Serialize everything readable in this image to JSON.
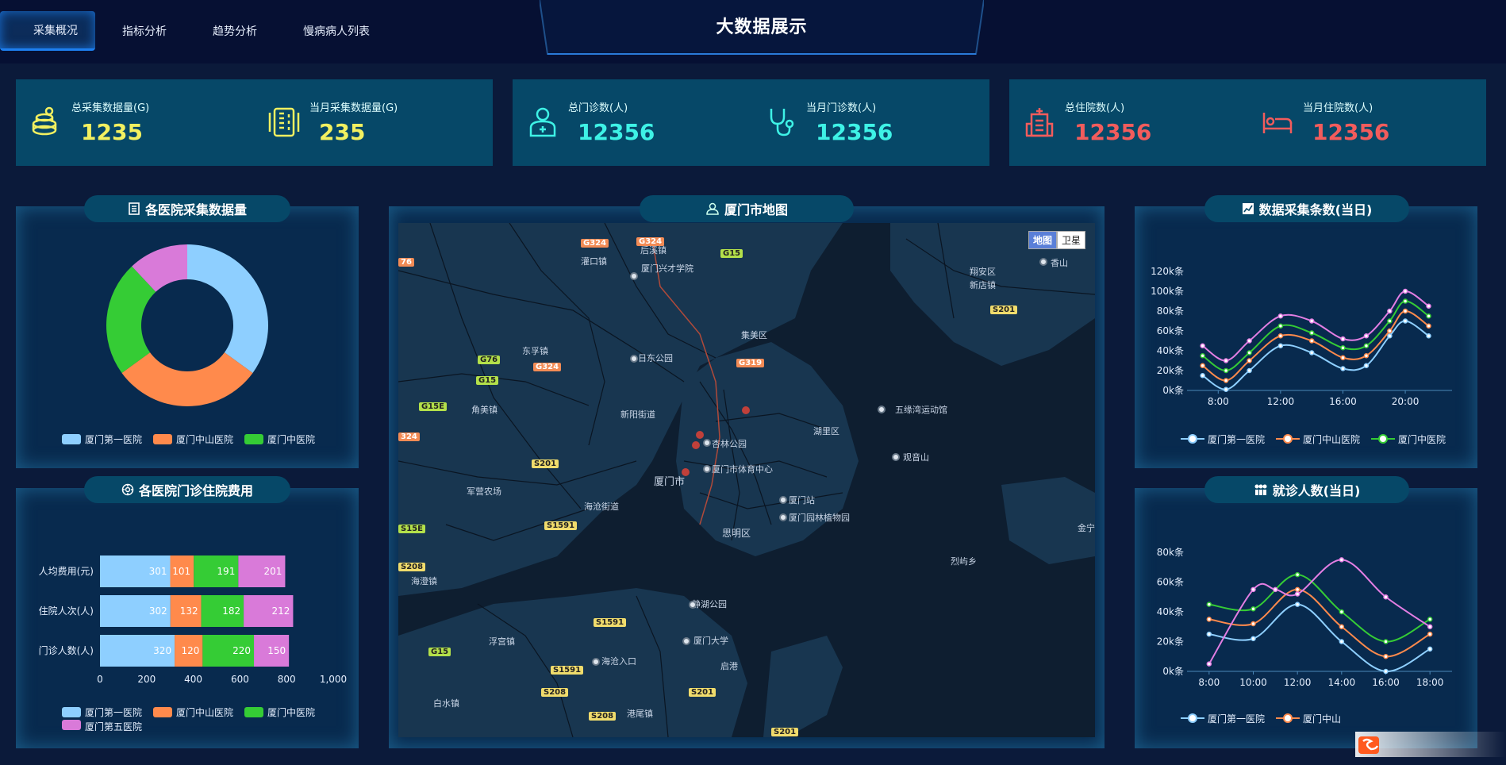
{
  "nav": {
    "tabs": [
      {
        "label": "采集概况",
        "active": true
      },
      {
        "label": "指标分析",
        "active": false
      },
      {
        "label": "趋势分析",
        "active": false
      },
      {
        "label": "慢病病人列表",
        "active": false
      }
    ]
  },
  "page_title": "大数据展示",
  "stats": [
    {
      "label": "总采集数据量(G)",
      "value": "1235",
      "color": "#f2f060",
      "icon": "database-coin-icon"
    },
    {
      "label": "当月采集数据量(G)",
      "value": "235",
      "color": "#f2f060",
      "icon": "server-rack-icon"
    },
    {
      "label": "总门诊数(人)",
      "value": "12356",
      "color": "#3ef2e6",
      "icon": "doctor-icon"
    },
    {
      "label": "当月门诊数(人)",
      "value": "12356",
      "color": "#3ef2e6",
      "icon": "stethoscope-icon"
    },
    {
      "label": "总住院数(人)",
      "value": "12356",
      "color": "#f25c5c",
      "icon": "hospital-icon"
    },
    {
      "label": "当月住院数(人)",
      "value": "12356",
      "color": "#f25c5c",
      "icon": "hospital-bed-icon"
    }
  ],
  "panels": {
    "donut_title": "各医院采集数据量",
    "bar_title": "各医院门诊住院费用",
    "map_title": "厦门市地图",
    "line1_title": "数据采集条数(当日)",
    "line2_title": "就诊人数(当日)"
  },
  "map": {
    "toggle": [
      "地图",
      "卫星"
    ],
    "labels": [
      "灌口镇",
      "后溪镇",
      "厦门兴才学院",
      "集美区",
      "日东公园",
      "东孚镇",
      "角美镇",
      "新阳街道",
      "杏林公园",
      "湖里区",
      "厦门市体育中心",
      "厦门市",
      "厦门站",
      "思明区",
      "厦门园林植物园",
      "五缘湾运动馆",
      "观音山",
      "翔安区",
      "新店镇",
      "香山",
      "军营农场",
      "海沧街道",
      "海澄镇",
      "静湖公园",
      "浮宫镇",
      "厦门大学",
      "海沧入口",
      "白水镇",
      "港尾镇",
      "启港",
      "烈屿乡",
      "金宁"
    ],
    "badges": [
      "G324",
      "G324",
      "G15",
      "G76",
      "G324",
      "G319",
      "G15",
      "G15E",
      "S201",
      "S201",
      "S1591",
      "S15E",
      "S208",
      "S1591",
      "G15",
      "S1591",
      "S208",
      "S201",
      "S208",
      "S201",
      "324",
      "76"
    ]
  },
  "chart_data": [
    {
      "type": "pie",
      "title": "各医院采集数据量",
      "donut": true,
      "slices": [
        {
          "name": "厦门第一医院",
          "value": 35,
          "color": "#8ecfff"
        },
        {
          "name": "厦门中山医院",
          "value": 30,
          "color": "#ff8a4c"
        },
        {
          "name": "厦门中医院",
          "value": 23,
          "color": "#35cc35"
        },
        {
          "name": "",
          "value": 12,
          "color": "#d97ad9"
        }
      ],
      "legend": [
        "厦门第一医院",
        "厦门中山医院",
        "厦门中医院"
      ],
      "legend_placement": "bottom"
    },
    {
      "type": "bar",
      "orientation": "horizontal",
      "stacked": true,
      "title": "各医院门诊住院费用",
      "categories": [
        "人均费用(元)",
        "住院人次(人)",
        "门诊人数(人)"
      ],
      "series": [
        {
          "name": "厦门第一医院",
          "color": "#8ecfff",
          "values": [
            301,
            302,
            320
          ]
        },
        {
          "name": "厦门中山医院",
          "color": "#ff8a4c",
          "values": [
            101,
            132,
            120
          ]
        },
        {
          "name": "厦门中医院",
          "color": "#35cc35",
          "values": [
            191,
            182,
            220
          ]
        },
        {
          "name": "厦门第五医院",
          "color": "#d97ad9",
          "values": [
            201,
            212,
            150
          ]
        }
      ],
      "xlim": [
        0,
        1000
      ],
      "xticks": [
        "0",
        "200",
        "400",
        "600",
        "800",
        "1,000"
      ],
      "legend_placement": "bottom"
    },
    {
      "type": "line",
      "title": "数据采集条数(当日)",
      "x": [
        7,
        8,
        9,
        10,
        11,
        12,
        13,
        14,
        15,
        16,
        17,
        18
      ],
      "xticks": [
        8,
        12,
        16,
        20
      ],
      "xtick_labels": [
        "8:00",
        "12:00",
        "16:00",
        "20:00"
      ],
      "xlim": [
        6,
        23
      ],
      "ylim": [
        0,
        120
      ],
      "yticks": [
        "0k条",
        "20k条",
        "40k条",
        "60k条",
        "80k条",
        "100k条",
        "120k条"
      ],
      "series": [
        {
          "name": "厦门第一医院",
          "color": "#8ecfff",
          "values": [
            15,
            1,
            20,
            45,
            38,
            22,
            25,
            55,
            70,
            55
          ],
          "x": [
            7,
            8.5,
            10,
            12,
            14,
            16,
            17.5,
            19,
            20,
            21.5
          ]
        },
        {
          "name": "厦门中山医院",
          "color": "#ff8a4c",
          "values": [
            25,
            10,
            30,
            55,
            50,
            33,
            35,
            60,
            80,
            65
          ],
          "x": [
            7,
            8.5,
            10,
            12,
            14,
            16,
            17.5,
            19,
            20,
            21.5
          ]
        },
        {
          "name": "厦门中医院",
          "color": "#35cc35",
          "values": [
            35,
            20,
            38,
            65,
            58,
            43,
            45,
            70,
            90,
            75
          ],
          "x": [
            7,
            8.5,
            10,
            12,
            14,
            16,
            17.5,
            19,
            20,
            21.5
          ]
        },
        {
          "name": "",
          "color": "#e37ee3",
          "values": [
            45,
            30,
            50,
            75,
            70,
            52,
            55,
            80,
            100,
            85
          ],
          "x": [
            7,
            8.5,
            10,
            12,
            14,
            16,
            17.5,
            19,
            20,
            21.5
          ]
        }
      ],
      "legend": [
        "厦门第一医院",
        "厦门中山医院",
        "厦门中医院"
      ],
      "legend_placement": "bottom"
    },
    {
      "type": "line",
      "title": "就诊人数(当日)",
      "xtick_labels": [
        "8:00",
        "10:00",
        "12:00",
        "14:00",
        "16:00",
        "18:00"
      ],
      "xticks": [
        8,
        10,
        12,
        14,
        16,
        18
      ],
      "xlim": [
        7,
        19
      ],
      "ylim": [
        0,
        80
      ],
      "yticks": [
        "0k条",
        "20k条",
        "40k条",
        "60k条",
        "80k条"
      ],
      "series": [
        {
          "name": "厦门第一医院",
          "color": "#8ecfff",
          "x": [
            8,
            10,
            12,
            14,
            16,
            18
          ],
          "values": [
            25,
            22,
            45,
            20,
            0,
            15
          ]
        },
        {
          "name": "厦门中山医院",
          "color": "#ff8a4c",
          "x": [
            8,
            10,
            12,
            14,
            16,
            18
          ],
          "values": [
            35,
            32,
            55,
            30,
            10,
            25
          ]
        },
        {
          "name": "厦门中医院",
          "color": "#35cc35",
          "x": [
            8,
            10,
            12,
            14,
            16,
            18
          ],
          "values": [
            45,
            42,
            65,
            40,
            20,
            35
          ]
        },
        {
          "name": "",
          "color": "#e37ee3",
          "x": [
            8,
            10,
            11,
            12,
            14,
            16,
            18
          ],
          "values": [
            5,
            55,
            55,
            52,
            75,
            50,
            30
          ]
        }
      ],
      "legend": [
        "厦门第一医院",
        "厦门中山"
      ],
      "legend_placement": "bottom"
    }
  ]
}
